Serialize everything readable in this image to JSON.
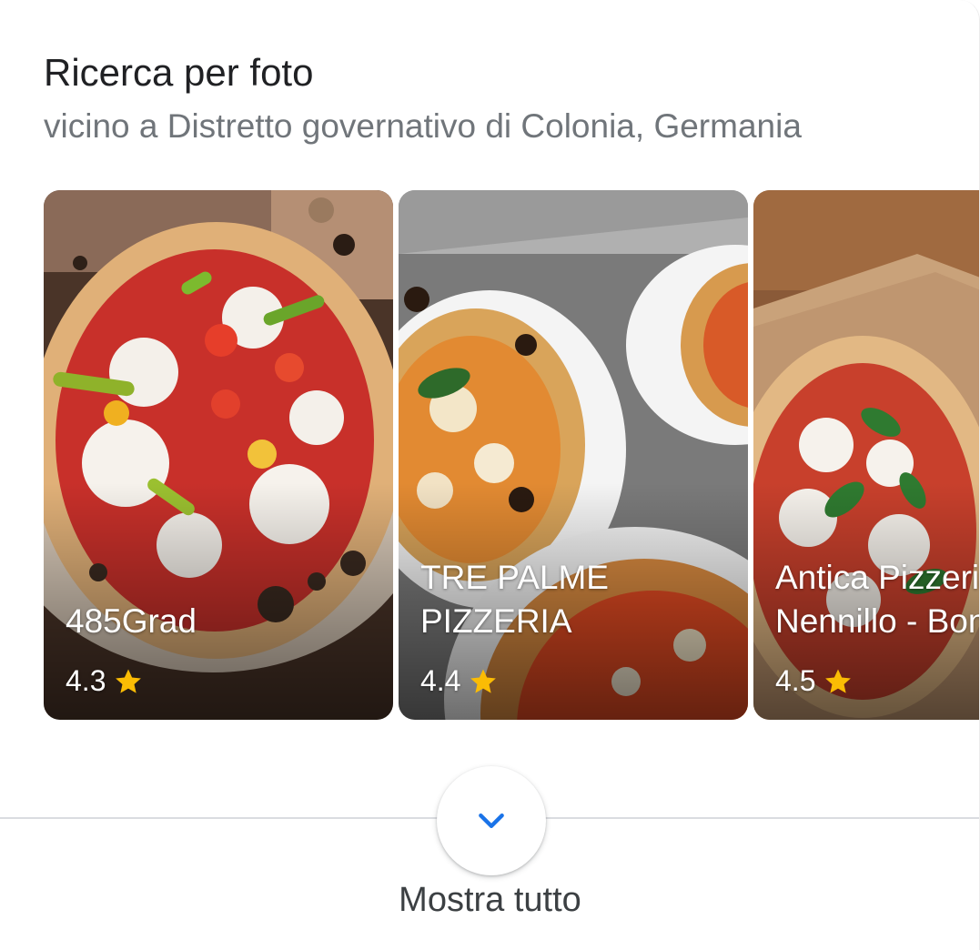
{
  "header": {
    "title": "Ricerca per foto",
    "subtitle": "vicino a Distretto governativo di Colonia, Germania"
  },
  "places": [
    {
      "name": "485Grad",
      "rating": "4.3",
      "icon": "star-icon",
      "photo": "pizza-with-cherry-tomatoes-and-peppers"
    },
    {
      "name": "TRE PALME\nPIZZERIA",
      "rating": "4.4",
      "icon": "star-icon",
      "photo": "margherita-pizzas-on-white-plates"
    },
    {
      "name": "Antica Pizzeria\nNennillo - Bonn",
      "rating": "4.5",
      "icon": "star-icon",
      "photo": "margherita-pizza-in-box"
    }
  ],
  "footer": {
    "show_all_label": "Mostra tutto",
    "expand_icon": "chevron-down-icon"
  },
  "colors": {
    "star": "#fbbc04",
    "accent_blue": "#1a73e8",
    "title_text": "#202124",
    "subtitle_text": "#70757a"
  }
}
